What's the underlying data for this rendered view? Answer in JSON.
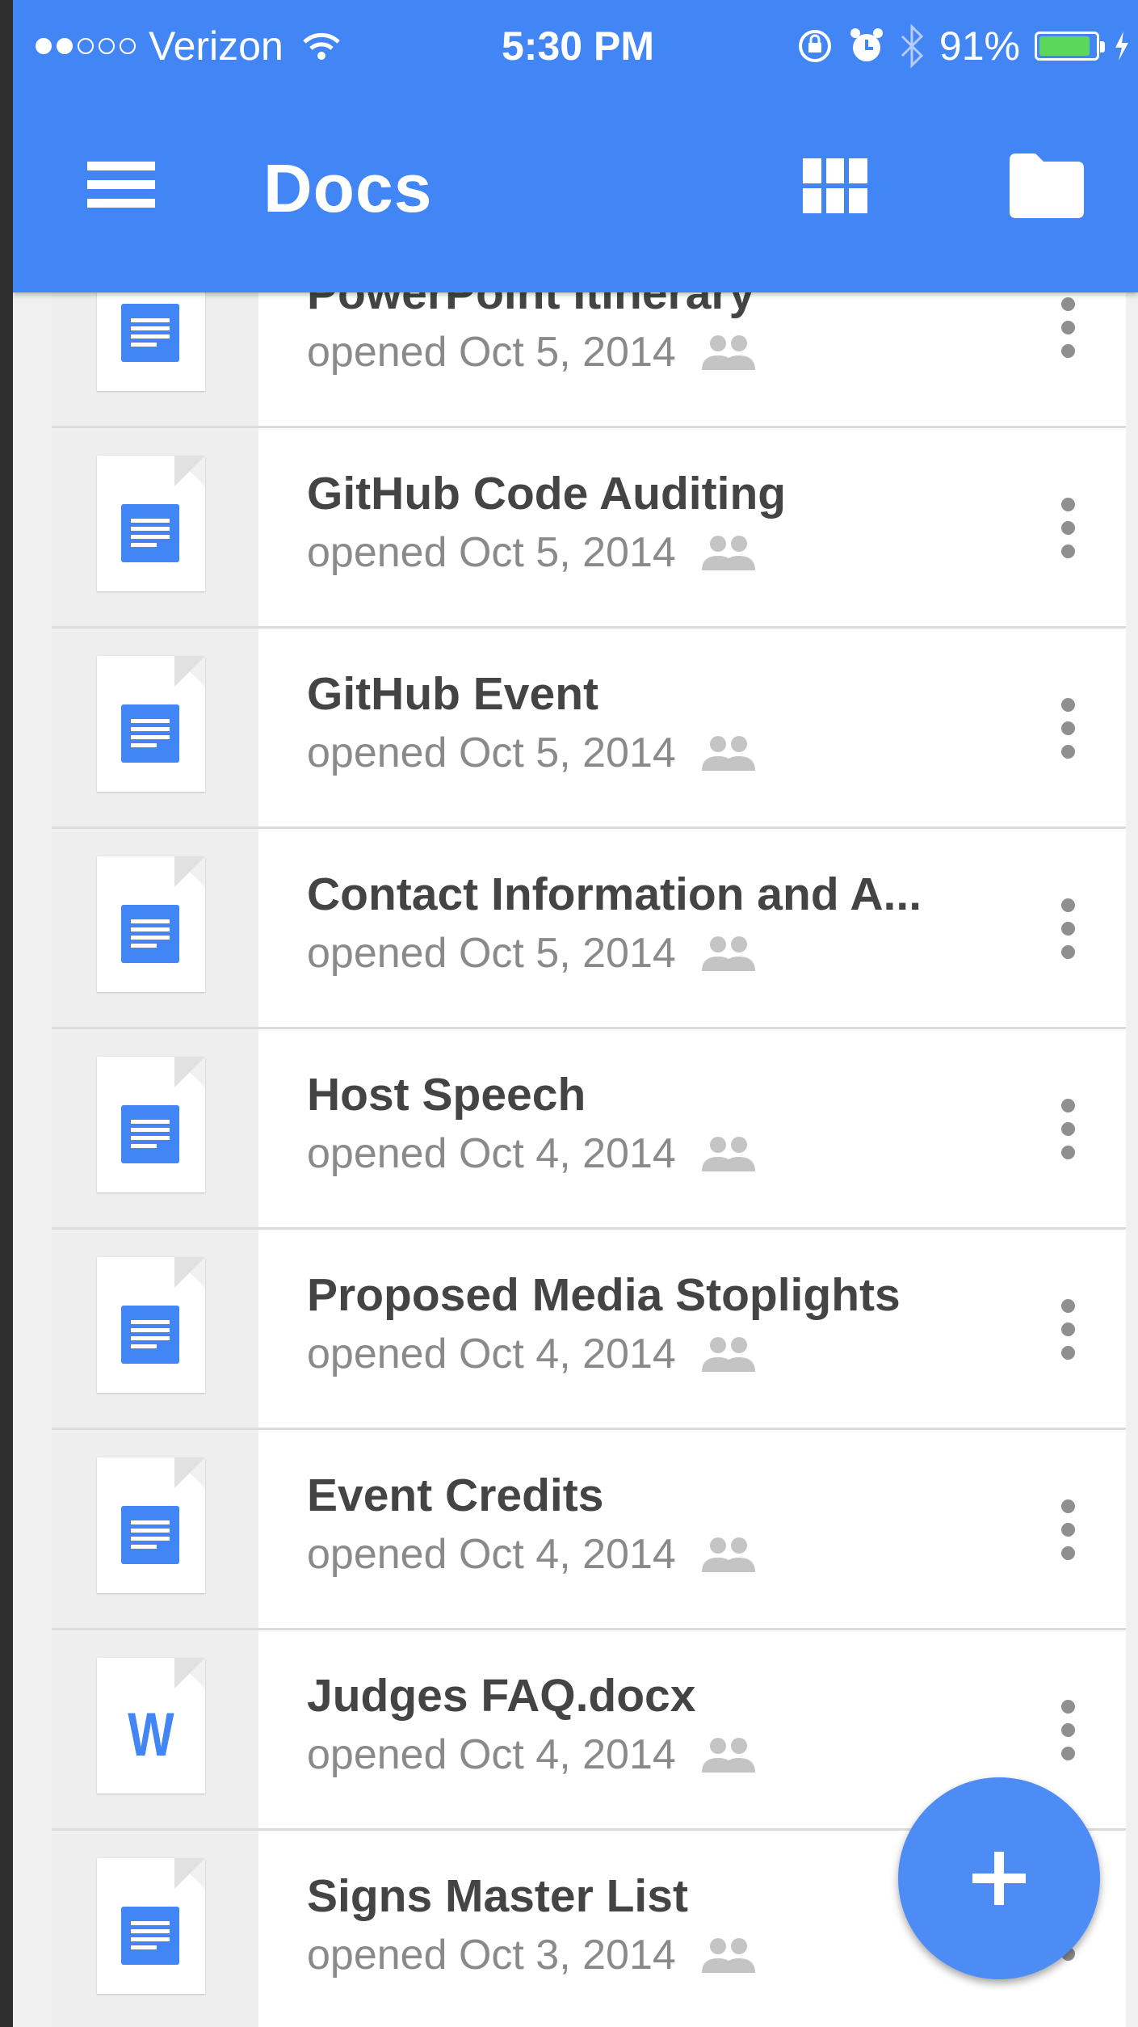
{
  "status_bar": {
    "carrier": "Verizon",
    "time": "5:30 PM",
    "battery": "91%",
    "battery_level": 0.91,
    "signal_bars_filled": 2,
    "signal_bars_total": 5
  },
  "app_bar": {
    "title": "Docs",
    "menu_icon": "hamburger-menu-icon",
    "grid_icon": "grid-view-icon",
    "folder_icon": "folder-icon",
    "color": "#4285f4"
  },
  "documents": [
    {
      "name": "PowerPoint Itinerary",
      "opened": "opened Oct 5, 2014",
      "type": "doc",
      "shared": true
    },
    {
      "name": "GitHub Code Auditing",
      "opened": "opened Oct 5, 2014",
      "type": "doc",
      "shared": true
    },
    {
      "name": "GitHub Event",
      "opened": "opened Oct 5, 2014",
      "type": "doc",
      "shared": true
    },
    {
      "name": "Contact Information and A...",
      "opened": "opened Oct 5, 2014",
      "type": "doc",
      "shared": true
    },
    {
      "name": "Host Speech",
      "opened": "opened Oct 4, 2014",
      "type": "doc",
      "shared": true
    },
    {
      "name": "Proposed Media Stoplights",
      "opened": "opened Oct 4, 2014",
      "type": "doc",
      "shared": true
    },
    {
      "name": "Event Credits",
      "opened": "opened Oct 4, 2014",
      "type": "doc",
      "shared": true
    },
    {
      "name": "Judges FAQ.docx",
      "opened": "opened Oct 4, 2014",
      "type": "word",
      "shared": true
    },
    {
      "name": "Signs Master List",
      "opened": "opened Oct 3, 2014",
      "type": "doc",
      "shared": true
    }
  ],
  "fab": {
    "icon": "plus-icon"
  }
}
